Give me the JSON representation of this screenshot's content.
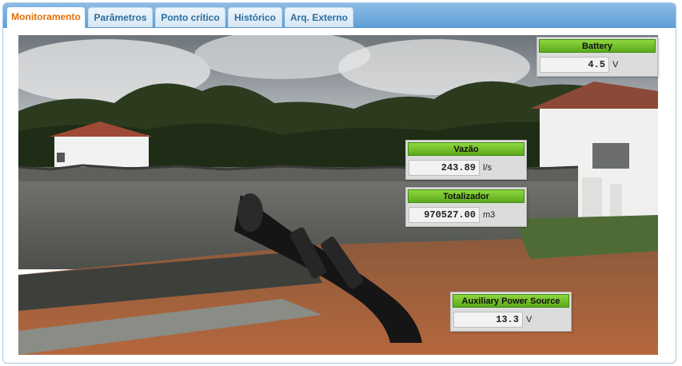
{
  "tabs": [
    "Monitoramento",
    "Parâmetros",
    "Ponto crítico",
    "Histórico",
    "Arq. Externo"
  ],
  "active_tab": "Monitoramento",
  "readings": {
    "battery": {
      "label": "Battery",
      "value": "4.5",
      "unit": "V"
    },
    "vazao": {
      "label": "Vazão",
      "value": "243.89",
      "unit": "l/s"
    },
    "totalizador": {
      "label": "Totalizador",
      "value": "970527.00",
      "unit": "m3"
    },
    "aux": {
      "label": "Auxiliary Power Source",
      "value": "13.3",
      "unit": "V"
    }
  },
  "colors": {
    "active_tab_text": "#e17009",
    "tab_text": "#2e6e9e",
    "header_green": "#6cbf24",
    "tab_bar": "#6fa9dc"
  }
}
